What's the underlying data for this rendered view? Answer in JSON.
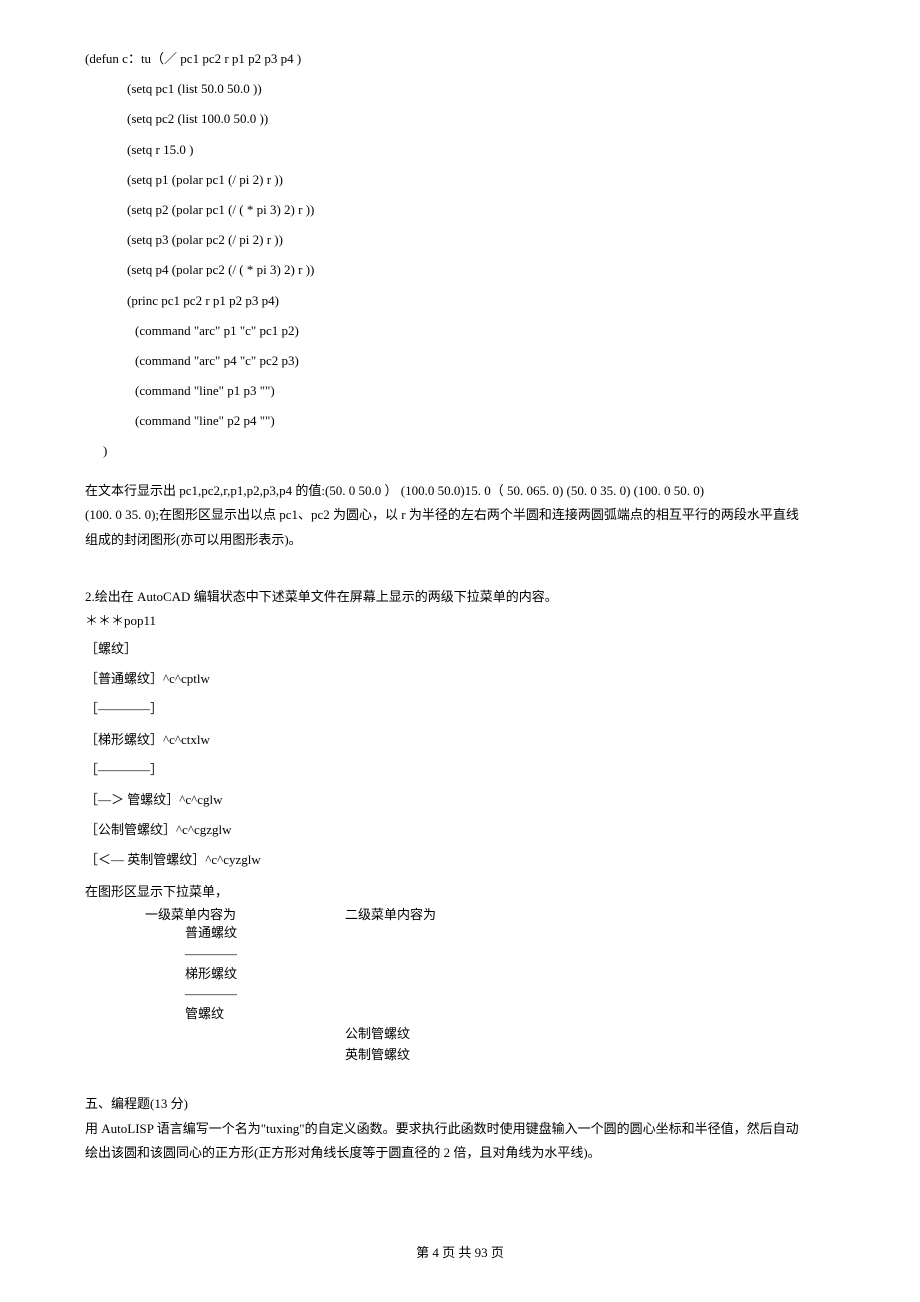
{
  "code": {
    "l0": "(defun c：tu（／  pc1   pc2   r   p1   p2   p3   p4 )",
    "l1": "(setq pc1 (list 50.0 50.0 ))",
    "l2": "(setq pc2 (list 100.0 50.0 ))",
    "l3": "(setq r 15.0 )",
    "l4": "(setq p1 (polar pc1 (/ pi 2) r ))",
    "l5": "(setq p2 (polar pc1 (/ ( * pi 3) 2) r ))",
    "l6": "(setq p3 (polar pc2 (/ pi 2) r ))",
    "l7": "(setq p4 (polar pc2 (/ ( * pi 3) 2) r ))",
    "l8": "(princ pc1 pc2 r p1 p2 p3 p4)",
    "l9": "(command \"arc\" p1 \"c\" pc1 p2)",
    "l10": "(command \"arc\" p4 \"c\" pc2 p3)",
    "l11": "(command \"line\" p1 p3 \"\")",
    "l12": "(command \"line\" p2 p4 \"\")",
    "l13": ")"
  },
  "ans1_line1": "在文本行显示出 pc1,pc2,r,p1,p2,p3,p4 的值:(50. 0 50.0 ）  (100.0 50.0)15. 0（ 50. 065. 0)  (50. 0 35. 0)  (100. 0 50. 0)",
  "ans1_line2": "(100. 0 35. 0);在图形区显示出以点 pc1、pc2 为圆心，以 r 为半径的左右两个半圆和连接两圆弧端点的相互平行的两段水平直线",
  "ans1_line3": "组成的封闭图形(亦可以用图形表示)。",
  "q2": {
    "title": "2.绘出在 AutoCAD 编辑状态中下述菜单文件在屏幕上显示的两级下拉菜单的内容。",
    "m0": "＊＊＊pop11",
    "m1": "［螺纹］",
    "m2": "［普通螺纹］^c^cptlw",
    "m3": "［————］",
    "m4": "［梯形螺纹］^c^ctxlw",
    "m5": "［————］",
    "m6": "［—＞ 管螺纹］^c^cglw",
    "m7": "［公制管螺纹］^c^cgzglw",
    "m8": "［＜— 英制管螺纹］^c^cyzglw"
  },
  "result": {
    "intro": "在图形区显示下拉菜单，",
    "col1_header": "一级菜单内容为",
    "col2_header": "二级菜单内容为",
    "item1": "普通螺纹",
    "sep1": "————",
    "item2": "梯形螺纹",
    "sep2": "————",
    "item3": "管螺纹",
    "sub1": "公制管螺纹",
    "sub2": "英制管螺纹"
  },
  "section5": {
    "title": "五、编程题(13 分)",
    "line1": "用 AutoLISP 语言编写一个名为\"tuxing\"的自定义函数。要求执行此函数时使用键盘输入一个圆的圆心坐标和半径值，然后自动",
    "line2": "绘出该圆和该圆同心的正方形(正方形对角线长度等于圆直径的 2 倍，且对角线为水平线)。"
  },
  "footer": "第 4 页 共 93 页"
}
